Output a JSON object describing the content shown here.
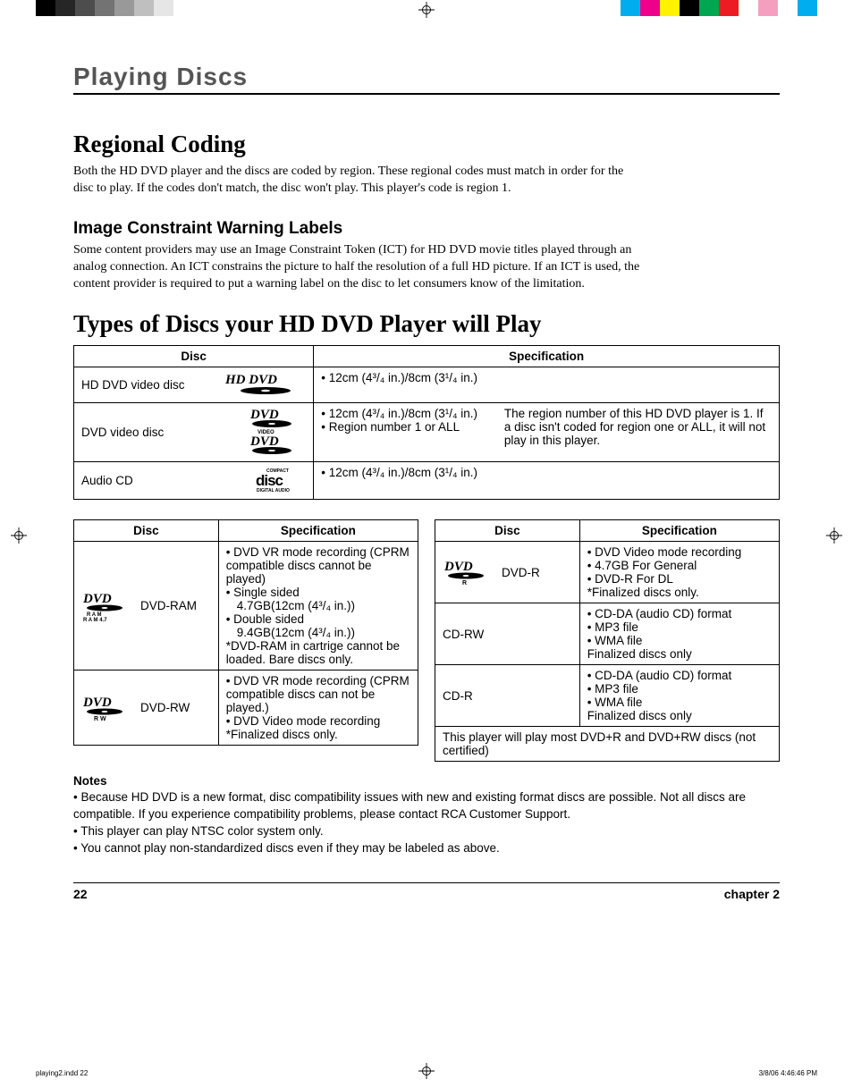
{
  "print_marks": {
    "left_bars": [
      "#000000",
      "#262626",
      "#4d4d4d",
      "#737373",
      "#999999",
      "#bfbfbf",
      "#e6e6e6",
      "#ffffff",
      "#ffffff",
      "#ffffff"
    ],
    "right_bars": [
      "#00aeef",
      "#ec008c",
      "#fff200",
      "#000000",
      "#00a651",
      "#ed1c24",
      "#ffffff",
      "#f59fbf",
      "#ffffff",
      "#00adef"
    ]
  },
  "section_title": "Playing Discs",
  "h1_regional": "Regional Coding",
  "p_regional": "Both the HD DVD player and the discs are coded by region. These regional codes must match in order for the disc to play. If the codes don't match, the disc won't play. This player's code is region 1.",
  "h2_image": "Image Constraint Warning Labels",
  "p_image": "Some content providers may use an Image Constraint Token (ICT) for HD DVD movie titles played through an analog connection. An ICT constrains the picture to half the resolution of a full HD picture. If an ICT is used, the content provider is required to put a warning label on the disc to let consumers know of the limitation.",
  "h1_types": "Types of Discs your HD DVD Player will Play",
  "table1": {
    "headers": {
      "disc": "Disc",
      "spec": "Specification"
    },
    "rows": [
      {
        "name": "HD DVD video disc",
        "logo": "hddvd",
        "spec": "• 12cm (4³/₄ in.)/8cm (3¹/₄ in.)",
        "extra": ""
      },
      {
        "name": "DVD video disc",
        "logo": "dvdvideo",
        "spec": "• 12cm (4³/₄ in.)/8cm (3¹/₄ in.)\n• Region number 1 or ALL",
        "extra": "The region number of this HD DVD player is 1. If a disc isn't coded for region one or ALL, it will not play in this player."
      },
      {
        "name": "Audio CD",
        "logo": "cd",
        "spec": "• 12cm (4³/₄ in.)/8cm (3¹/₄ in.)",
        "extra": ""
      }
    ]
  },
  "table_left": {
    "headers": {
      "disc": "Disc",
      "spec": "Specification"
    },
    "rows": [
      {
        "name": "DVD-RAM",
        "logo": "dvdram",
        "spec_lines": [
          "• DVD VR mode recording (CPRM compatible discs cannot be played)",
          "• Single sided",
          "  4.7GB(12cm (4³/₄ in.))",
          "• Double sided",
          "  9.4GB(12cm (4³/₄ in.))",
          "*DVD-RAM in cartrige cannot be loaded. Bare discs only."
        ]
      },
      {
        "name": "DVD-RW",
        "logo": "dvdrw",
        "spec_lines": [
          "• DVD VR mode recording (CPRM compatible discs can not be played.)",
          "• DVD Video mode recording",
          "*Finalized discs only."
        ]
      }
    ]
  },
  "table_right": {
    "headers": {
      "disc": "Disc",
      "spec": "Specification"
    },
    "rows": [
      {
        "name": "DVD-R",
        "logo": "dvdr",
        "spec_lines": [
          "• DVD Video mode recording",
          "• 4.7GB For General",
          "• DVD-R For DL",
          "*Finalized discs only."
        ]
      },
      {
        "name": "CD-RW",
        "logo": "",
        "spec_lines": [
          "• CD-DA (audio CD) format",
          "• MP3 file",
          "• WMA file",
          "Finalized discs only"
        ]
      },
      {
        "name": "CD-R",
        "logo": "",
        "spec_lines": [
          "• CD-DA (audio CD) format",
          "• MP3 file",
          "• WMA file",
          "Finalized discs only"
        ]
      }
    ],
    "footer_row": "This player will play most DVD+R and DVD+RW discs (not certified)"
  },
  "notes_head": "Notes",
  "notes": [
    "Because HD DVD is a new format, disc compatibility issues with new and existing format discs are possible. Not all discs are compatible. If you experience compatibility problems, please contact  RCA Customer Support.",
    "This player can play NTSC color system only.",
    "You cannot play non-standardized discs even if they may be labeled as above."
  ],
  "footer": {
    "page": "22",
    "chapter": "chapter 2"
  },
  "print_footer": {
    "left": "playing2.indd   22",
    "right": "3/8/06   4:46:46 PM"
  }
}
